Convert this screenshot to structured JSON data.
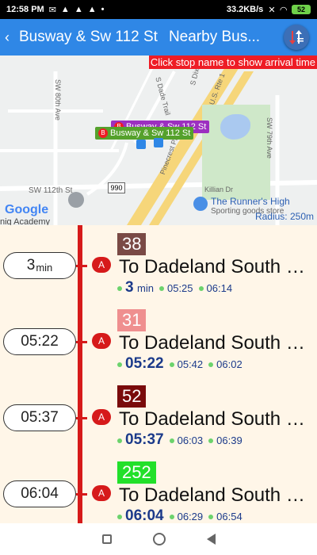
{
  "status": {
    "time": "12:58 PM",
    "speed": "33.2KB/s",
    "battery": "52"
  },
  "appbar": {
    "title": "Busway & Sw 112 St",
    "nearby": "Nearby Bus..."
  },
  "map": {
    "hint": "Click stop name to show arrival time",
    "labels": {
      "sw80": "SW 80th Ave",
      "dadetrail": "S Dade Trail",
      "dixiehwy": "S Dixie Hwy",
      "usrte1": "U.S. Rte 1",
      "pinecrest": "Pinecrest Pkwy",
      "sw79": "SW 79th Ave",
      "killian": "Killian Dr",
      "sw112": "SW 112th St",
      "route990": "990"
    },
    "stop_tags": [
      {
        "letter": "B",
        "name": "Busway & Sw 112 St",
        "color": "#9c2fc0"
      },
      {
        "letter": "B",
        "name": "Busway & Sw 112 St",
        "color": "#55a12c"
      }
    ],
    "google": "Google",
    "academy": "nig Academy",
    "poi_name": "The Runner's High",
    "poi_sub": "Sporting goods store",
    "radius": "Radius: 250m"
  },
  "arrivals": [
    {
      "eta": "3",
      "eta_unit": "min",
      "stop_letter": "A",
      "route": "38",
      "route_color": "#7a4a45",
      "dest": "To Dadeland South Metrorail Station",
      "next_main": "3",
      "next_unit": "min",
      "later": [
        "05:25",
        "06:14"
      ]
    },
    {
      "eta": "05:22",
      "eta_unit": "",
      "stop_letter": "A",
      "route": "31",
      "route_color": "#ef8f8f",
      "dest": "To Dadeland South Metrorail Station",
      "next_main": "05:22",
      "next_unit": "",
      "later": [
        "05:42",
        "06:02"
      ]
    },
    {
      "eta": "05:37",
      "eta_unit": "",
      "stop_letter": "A",
      "route": "52",
      "route_color": "#7a0b0b",
      "dest": "To Dadeland South Metrorail Station",
      "next_main": "05:37",
      "next_unit": "",
      "later": [
        "06:03",
        "06:39"
      ]
    },
    {
      "eta": "06:04",
      "eta_unit": "",
      "stop_letter": "A",
      "route": "252",
      "route_color": "#22e02a",
      "dest": "To Dadeland South Metrorail Station",
      "next_main": "06:04",
      "next_unit": "",
      "later": [
        "06:29",
        "06:54"
      ]
    }
  ]
}
